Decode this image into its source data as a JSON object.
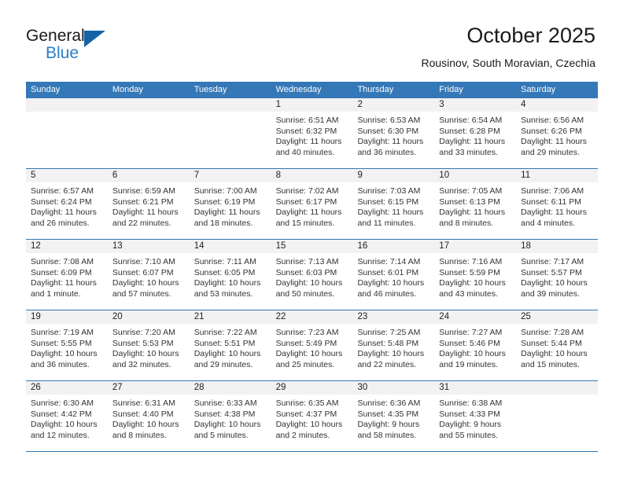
{
  "brand": {
    "name_top": "General",
    "name_bottom": "Blue",
    "triangle_icon": "triangle-icon",
    "accent_color": "#2a7fc9"
  },
  "header": {
    "title": "October 2025",
    "subtitle": "Rousinov, South Moravian, Czechia"
  },
  "calendar": {
    "header_bg": "#3478b8",
    "daynum_bg": "#f2f2f2",
    "weekday_headers": [
      "Sunday",
      "Monday",
      "Tuesday",
      "Wednesday",
      "Thursday",
      "Friday",
      "Saturday"
    ],
    "weeks": [
      [
        {
          "day": "",
          "empty": true,
          "sunrise": "",
          "sunset": "",
          "daylight1": "",
          "daylight2": ""
        },
        {
          "day": "",
          "empty": true,
          "sunrise": "",
          "sunset": "",
          "daylight1": "",
          "daylight2": ""
        },
        {
          "day": "",
          "empty": true,
          "sunrise": "",
          "sunset": "",
          "daylight1": "",
          "daylight2": ""
        },
        {
          "day": "1",
          "empty": false,
          "sunrise": "Sunrise: 6:51 AM",
          "sunset": "Sunset: 6:32 PM",
          "daylight1": "Daylight: 11 hours",
          "daylight2": "and 40 minutes."
        },
        {
          "day": "2",
          "empty": false,
          "sunrise": "Sunrise: 6:53 AM",
          "sunset": "Sunset: 6:30 PM",
          "daylight1": "Daylight: 11 hours",
          "daylight2": "and 36 minutes."
        },
        {
          "day": "3",
          "empty": false,
          "sunrise": "Sunrise: 6:54 AM",
          "sunset": "Sunset: 6:28 PM",
          "daylight1": "Daylight: 11 hours",
          "daylight2": "and 33 minutes."
        },
        {
          "day": "4",
          "empty": false,
          "sunrise": "Sunrise: 6:56 AM",
          "sunset": "Sunset: 6:26 PM",
          "daylight1": "Daylight: 11 hours",
          "daylight2": "and 29 minutes."
        }
      ],
      [
        {
          "day": "5",
          "empty": false,
          "sunrise": "Sunrise: 6:57 AM",
          "sunset": "Sunset: 6:24 PM",
          "daylight1": "Daylight: 11 hours",
          "daylight2": "and 26 minutes."
        },
        {
          "day": "6",
          "empty": false,
          "sunrise": "Sunrise: 6:59 AM",
          "sunset": "Sunset: 6:21 PM",
          "daylight1": "Daylight: 11 hours",
          "daylight2": "and 22 minutes."
        },
        {
          "day": "7",
          "empty": false,
          "sunrise": "Sunrise: 7:00 AM",
          "sunset": "Sunset: 6:19 PM",
          "daylight1": "Daylight: 11 hours",
          "daylight2": "and 18 minutes."
        },
        {
          "day": "8",
          "empty": false,
          "sunrise": "Sunrise: 7:02 AM",
          "sunset": "Sunset: 6:17 PM",
          "daylight1": "Daylight: 11 hours",
          "daylight2": "and 15 minutes."
        },
        {
          "day": "9",
          "empty": false,
          "sunrise": "Sunrise: 7:03 AM",
          "sunset": "Sunset: 6:15 PM",
          "daylight1": "Daylight: 11 hours",
          "daylight2": "and 11 minutes."
        },
        {
          "day": "10",
          "empty": false,
          "sunrise": "Sunrise: 7:05 AM",
          "sunset": "Sunset: 6:13 PM",
          "daylight1": "Daylight: 11 hours",
          "daylight2": "and 8 minutes."
        },
        {
          "day": "11",
          "empty": false,
          "sunrise": "Sunrise: 7:06 AM",
          "sunset": "Sunset: 6:11 PM",
          "daylight1": "Daylight: 11 hours",
          "daylight2": "and 4 minutes."
        }
      ],
      [
        {
          "day": "12",
          "empty": false,
          "sunrise": "Sunrise: 7:08 AM",
          "sunset": "Sunset: 6:09 PM",
          "daylight1": "Daylight: 11 hours",
          "daylight2": "and 1 minute."
        },
        {
          "day": "13",
          "empty": false,
          "sunrise": "Sunrise: 7:10 AM",
          "sunset": "Sunset: 6:07 PM",
          "daylight1": "Daylight: 10 hours",
          "daylight2": "and 57 minutes."
        },
        {
          "day": "14",
          "empty": false,
          "sunrise": "Sunrise: 7:11 AM",
          "sunset": "Sunset: 6:05 PM",
          "daylight1": "Daylight: 10 hours",
          "daylight2": "and 53 minutes."
        },
        {
          "day": "15",
          "empty": false,
          "sunrise": "Sunrise: 7:13 AM",
          "sunset": "Sunset: 6:03 PM",
          "daylight1": "Daylight: 10 hours",
          "daylight2": "and 50 minutes."
        },
        {
          "day": "16",
          "empty": false,
          "sunrise": "Sunrise: 7:14 AM",
          "sunset": "Sunset: 6:01 PM",
          "daylight1": "Daylight: 10 hours",
          "daylight2": "and 46 minutes."
        },
        {
          "day": "17",
          "empty": false,
          "sunrise": "Sunrise: 7:16 AM",
          "sunset": "Sunset: 5:59 PM",
          "daylight1": "Daylight: 10 hours",
          "daylight2": "and 43 minutes."
        },
        {
          "day": "18",
          "empty": false,
          "sunrise": "Sunrise: 7:17 AM",
          "sunset": "Sunset: 5:57 PM",
          "daylight1": "Daylight: 10 hours",
          "daylight2": "and 39 minutes."
        }
      ],
      [
        {
          "day": "19",
          "empty": false,
          "sunrise": "Sunrise: 7:19 AM",
          "sunset": "Sunset: 5:55 PM",
          "daylight1": "Daylight: 10 hours",
          "daylight2": "and 36 minutes."
        },
        {
          "day": "20",
          "empty": false,
          "sunrise": "Sunrise: 7:20 AM",
          "sunset": "Sunset: 5:53 PM",
          "daylight1": "Daylight: 10 hours",
          "daylight2": "and 32 minutes."
        },
        {
          "day": "21",
          "empty": false,
          "sunrise": "Sunrise: 7:22 AM",
          "sunset": "Sunset: 5:51 PM",
          "daylight1": "Daylight: 10 hours",
          "daylight2": "and 29 minutes."
        },
        {
          "day": "22",
          "empty": false,
          "sunrise": "Sunrise: 7:23 AM",
          "sunset": "Sunset: 5:49 PM",
          "daylight1": "Daylight: 10 hours",
          "daylight2": "and 25 minutes."
        },
        {
          "day": "23",
          "empty": false,
          "sunrise": "Sunrise: 7:25 AM",
          "sunset": "Sunset: 5:48 PM",
          "daylight1": "Daylight: 10 hours",
          "daylight2": "and 22 minutes."
        },
        {
          "day": "24",
          "empty": false,
          "sunrise": "Sunrise: 7:27 AM",
          "sunset": "Sunset: 5:46 PM",
          "daylight1": "Daylight: 10 hours",
          "daylight2": "and 19 minutes."
        },
        {
          "day": "25",
          "empty": false,
          "sunrise": "Sunrise: 7:28 AM",
          "sunset": "Sunset: 5:44 PM",
          "daylight1": "Daylight: 10 hours",
          "daylight2": "and 15 minutes."
        }
      ],
      [
        {
          "day": "26",
          "empty": false,
          "sunrise": "Sunrise: 6:30 AM",
          "sunset": "Sunset: 4:42 PM",
          "daylight1": "Daylight: 10 hours",
          "daylight2": "and 12 minutes."
        },
        {
          "day": "27",
          "empty": false,
          "sunrise": "Sunrise: 6:31 AM",
          "sunset": "Sunset: 4:40 PM",
          "daylight1": "Daylight: 10 hours",
          "daylight2": "and 8 minutes."
        },
        {
          "day": "28",
          "empty": false,
          "sunrise": "Sunrise: 6:33 AM",
          "sunset": "Sunset: 4:38 PM",
          "daylight1": "Daylight: 10 hours",
          "daylight2": "and 5 minutes."
        },
        {
          "day": "29",
          "empty": false,
          "sunrise": "Sunrise: 6:35 AM",
          "sunset": "Sunset: 4:37 PM",
          "daylight1": "Daylight: 10 hours",
          "daylight2": "and 2 minutes."
        },
        {
          "day": "30",
          "empty": false,
          "sunrise": "Sunrise: 6:36 AM",
          "sunset": "Sunset: 4:35 PM",
          "daylight1": "Daylight: 9 hours",
          "daylight2": "and 58 minutes."
        },
        {
          "day": "31",
          "empty": false,
          "sunrise": "Sunrise: 6:38 AM",
          "sunset": "Sunset: 4:33 PM",
          "daylight1": "Daylight: 9 hours",
          "daylight2": "and 55 minutes."
        },
        {
          "day": "",
          "empty": true,
          "sunrise": "",
          "sunset": "",
          "daylight1": "",
          "daylight2": ""
        }
      ]
    ]
  }
}
